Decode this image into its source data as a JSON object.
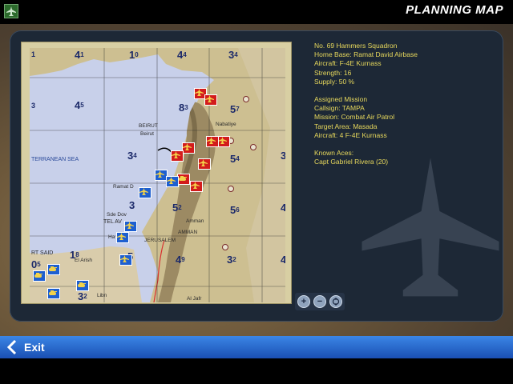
{
  "header": {
    "title": "PLANNING MAP",
    "menu_icon": "jet-icon"
  },
  "map": {
    "sectors": [
      {
        "n": "1",
        "s": ""
      },
      {
        "n": "4",
        "s": "1"
      },
      {
        "n": "1",
        "s": "0"
      },
      {
        "n": "4",
        "s": "4"
      },
      {
        "n": "3",
        "s": "4"
      },
      {
        "n": "3",
        "s": ""
      },
      {
        "n": "4",
        "s": "5"
      },
      {
        "n": "8",
        "s": "3"
      },
      {
        "n": "5",
        "s": "7"
      },
      {
        "n": "3",
        "s": "4"
      },
      {
        "n": "5",
        "s": "4"
      },
      {
        "n": "3",
        "s": ""
      },
      {
        "n": "3",
        "s": ""
      },
      {
        "n": "5",
        "s": "2"
      },
      {
        "n": "5",
        "s": "6"
      },
      {
        "n": "4",
        "s": ""
      },
      {
        "n": "1",
        "s": "8"
      },
      {
        "n": "5",
        "s": ""
      },
      {
        "n": "4",
        "s": "9"
      },
      {
        "n": "3",
        "s": "2"
      },
      {
        "n": "4",
        "s": ""
      },
      {
        "n": "0",
        "s": "5"
      },
      {
        "n": "3",
        "s": "2"
      }
    ],
    "places": [
      "BEIRUT",
      "Beirut",
      "Nabatiye",
      "Ramat D",
      "Sde Dov",
      "TEL AV",
      "Ha",
      "JERUSALEM",
      "AMMAN",
      "Amman",
      "RT SAID",
      "El Arish",
      "Al Jafr",
      "Libn"
    ],
    "sea_label": "TERRANEAN SEA"
  },
  "info": {
    "squadron": "No. 69 Hammers Squadron",
    "home_base": "Home Base: Ramat David Airbase",
    "aircraft": "Aircraft: F-4E Kurnass",
    "strength": "Strength: 16",
    "supply": "Supply: 50 %",
    "mission_heading": "Assigned Mission",
    "callsign": "Callsign: TAMPA",
    "mission": "Mission: Combat Air Patrol",
    "target": "Target Area: Masada",
    "mission_aircraft": "Aircraft: 4 F-4E Kurnass",
    "aces_heading": "Known Aces:",
    "ace_1": "Capt Gabriel Rivera  (20)"
  },
  "zoom": {
    "in": "+",
    "out": "−",
    "reset_icon": "recenter-icon"
  },
  "footer": {
    "exit_label": "Exit"
  },
  "colors": {
    "title_text": "#ffffff",
    "info_text": "#e7d85c",
    "sector_text": "#1c2a6a",
    "hostile": "#d21c1c",
    "friendly": "#1e5fd0",
    "bottom_bar": "#2f72d8"
  }
}
